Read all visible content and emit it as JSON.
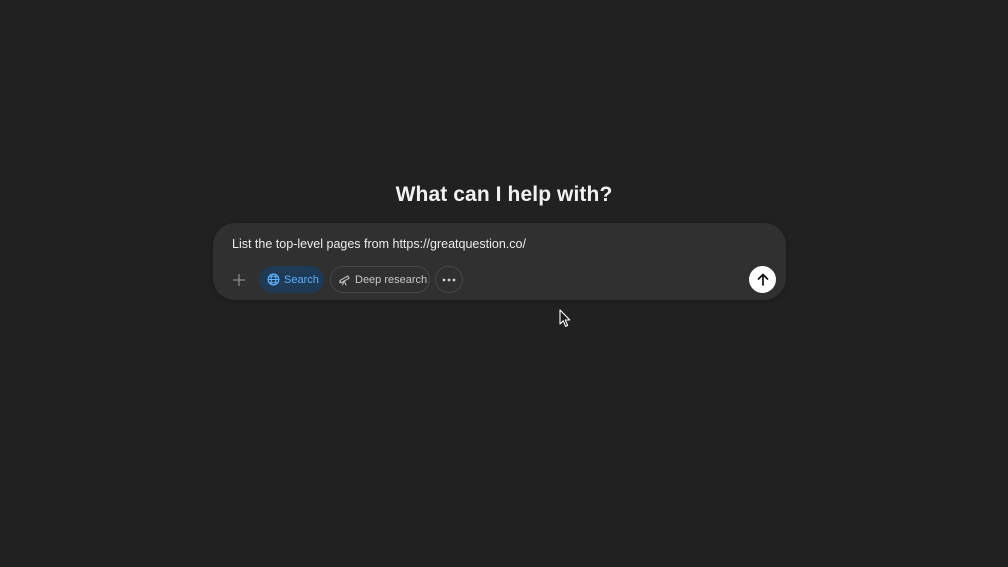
{
  "headline": "What can I help with?",
  "composer": {
    "prompt_text": "List the top-level pages from https://greatquestion.co/",
    "tools": {
      "search_label": "Search",
      "deep_research_label": "Deep research"
    }
  },
  "icons": {
    "attach": "plus-icon",
    "search": "globe-icon",
    "deep_research": "telescope-icon",
    "more": "ellipsis-icon",
    "send": "arrow-up-icon",
    "pointer": "mouse-cursor-icon"
  },
  "colors": {
    "background": "#212121",
    "composer": "#303030",
    "search_active_bg": "#1e3a55",
    "search_active_fg": "#5eb2ff",
    "send_button": "#ffffff"
  }
}
